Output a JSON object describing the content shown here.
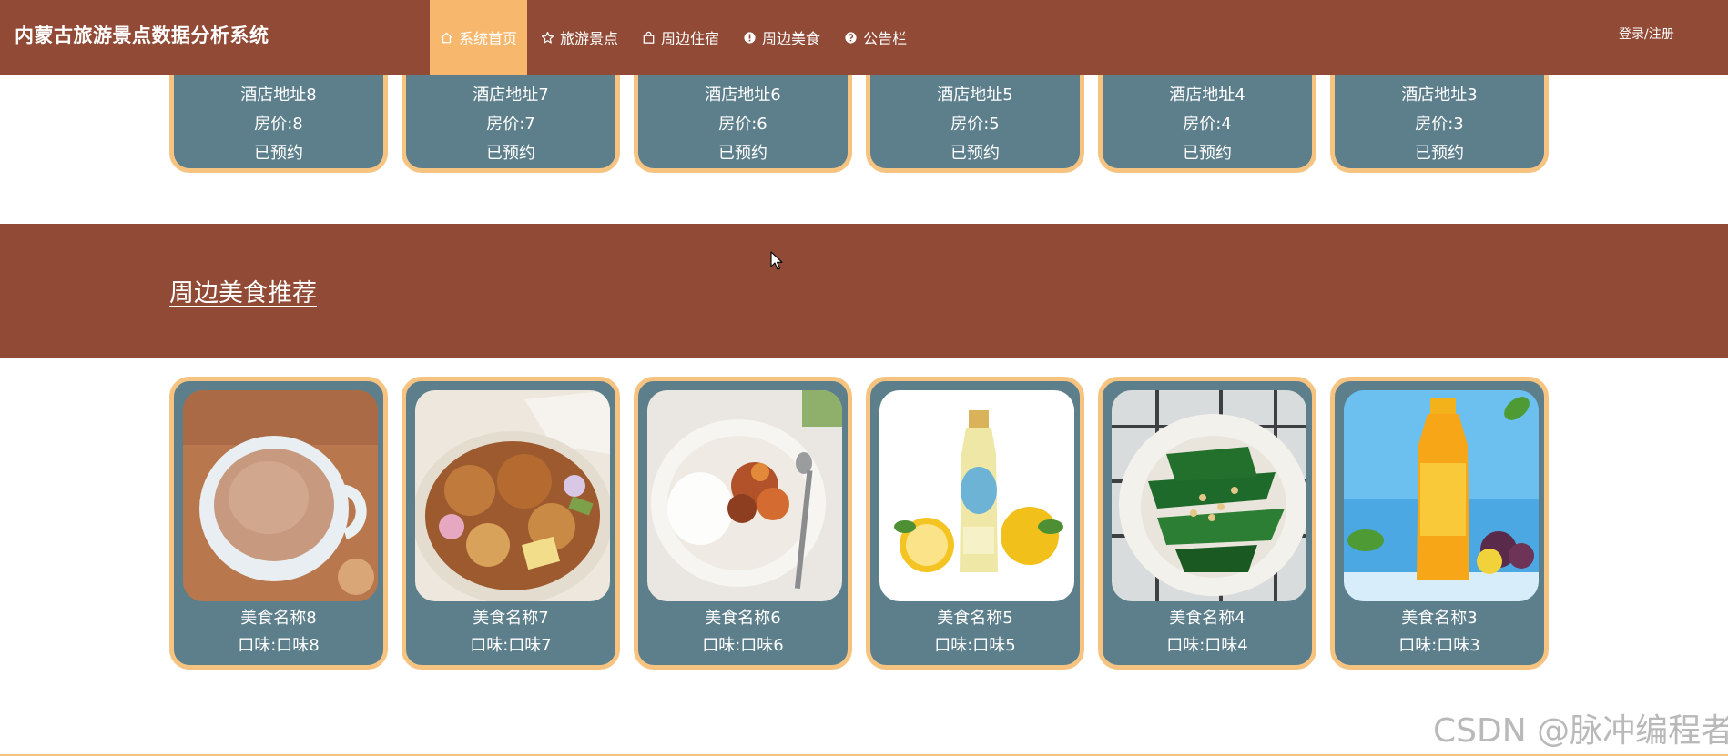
{
  "header": {
    "brand": "内蒙古旅游景点数据分析系统",
    "nav": [
      {
        "label": "系统首页",
        "icon": "home-icon",
        "active": true
      },
      {
        "label": "旅游景点",
        "icon": "star-icon",
        "active": false
      },
      {
        "label": "周边住宿",
        "icon": "bag-icon",
        "active": false
      },
      {
        "label": "周边美食",
        "icon": "info-icon",
        "active": false
      },
      {
        "label": "公告栏",
        "icon": "help-icon",
        "active": false
      }
    ],
    "login": "登录/注册"
  },
  "hotels": [
    {
      "address": "酒店地址8",
      "price": "房价:8",
      "status": "已预约"
    },
    {
      "address": "酒店地址7",
      "price": "房价:7",
      "status": "已预约"
    },
    {
      "address": "酒店地址6",
      "price": "房价:6",
      "status": "已预约"
    },
    {
      "address": "酒店地址5",
      "price": "房价:5",
      "status": "已预约"
    },
    {
      "address": "酒店地址4",
      "price": "房价:4",
      "status": "已预约"
    },
    {
      "address": "酒店地址3",
      "price": "房价:3",
      "status": "已预约"
    }
  ],
  "food_section": {
    "title": "周边美食推荐"
  },
  "foods": [
    {
      "name": "美食名称8",
      "taste": "口味:口味8",
      "image": "milk-tea-image"
    },
    {
      "name": "美食名称7",
      "taste": "口味:口味7",
      "image": "braised-chicken-image"
    },
    {
      "name": "美食名称6",
      "taste": "口味:口味6",
      "image": "rice-plate-image"
    },
    {
      "name": "美食名称5",
      "taste": "口味:口味5",
      "image": "lemonade-image"
    },
    {
      "name": "美食名称4",
      "taste": "口味:口味4",
      "image": "greens-plate-image"
    },
    {
      "name": "美食名称3",
      "taste": "口味:口味3",
      "image": "juice-bottle-image"
    }
  ],
  "colors": {
    "header_bg": "#914A35",
    "active_tab": "#F7B86E",
    "card_bg": "#5D7F8C",
    "card_border": "#F6C480"
  },
  "watermark": "CSDN @脉冲编程者"
}
